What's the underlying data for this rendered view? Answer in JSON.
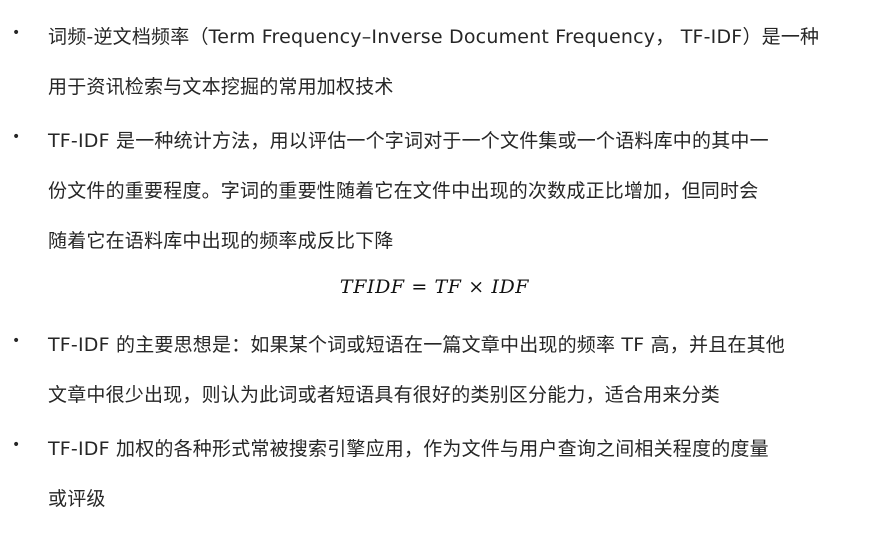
{
  "bullets": [
    {
      "marker": "•",
      "lines": [
        "词频-逆文档频率（Term Frequency–Inverse Document Frequency， TF-IDF）是一种",
        "用于资讯检索与文本挖掘的常用加权技术"
      ]
    },
    {
      "marker": "•",
      "lines": [
        "TF-IDF 是一种统计方法，用以评估一个字词对于一个文件集或一个语料库中的其中一",
        "份文件的重要程度。字词的重要性随着它在文件中出现的次数成正比增加，但同时会",
        "随着它在语料库中出现的频率成反比下降"
      ]
    },
    {
      "marker": "•",
      "lines": [
        "TF-IDF 的主要思想是：如果某个词或短语在一篇文章中出现的频率 TF 高，并且在其他",
        "文章中很少出现，则认为此词或者短语具有很好的类别区分能力，适合用来分类"
      ]
    },
    {
      "marker": "•",
      "lines": [
        "TF-IDF 加权的各种形式常被搜索引擎应用，作为文件与用户查询之间相关程度的度量",
        "或评级"
      ]
    }
  ],
  "formula": "TFIDF = TF × IDF"
}
